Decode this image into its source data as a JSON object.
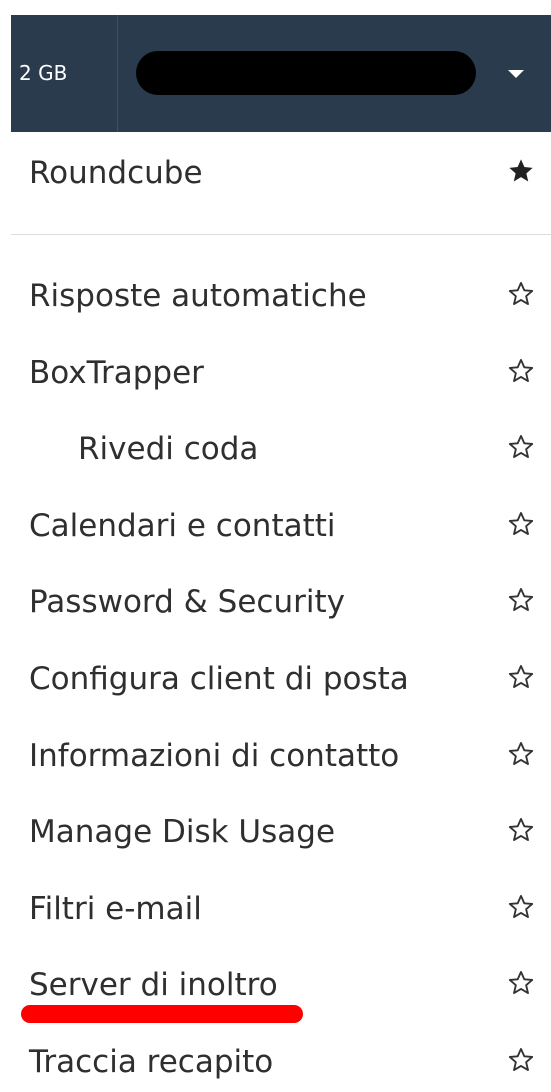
{
  "header": {
    "quota_label": "2 GB"
  },
  "menu": {
    "pinned": {
      "label": "Roundcube",
      "favorited": true
    },
    "items": [
      {
        "label": "Risposte automatiche",
        "indent": false
      },
      {
        "label": "BoxTrapper",
        "indent": false
      },
      {
        "label": "Rivedi coda",
        "indent": true
      },
      {
        "label": "Calendari e contatti",
        "indent": false
      },
      {
        "label": "Password & Security",
        "indent": false
      },
      {
        "label": "Configura client di posta",
        "indent": false
      },
      {
        "label": "Informazioni di contatto",
        "indent": false
      },
      {
        "label": "Manage Disk Usage",
        "indent": false
      },
      {
        "label": "Filtri e-mail",
        "indent": false
      },
      {
        "label": "Server di inoltro",
        "indent": false
      },
      {
        "label": "Traccia recapito",
        "indent": false
      }
    ]
  },
  "colors": {
    "header_bg": "#2b3b4e",
    "highlight": "#ff0000"
  }
}
